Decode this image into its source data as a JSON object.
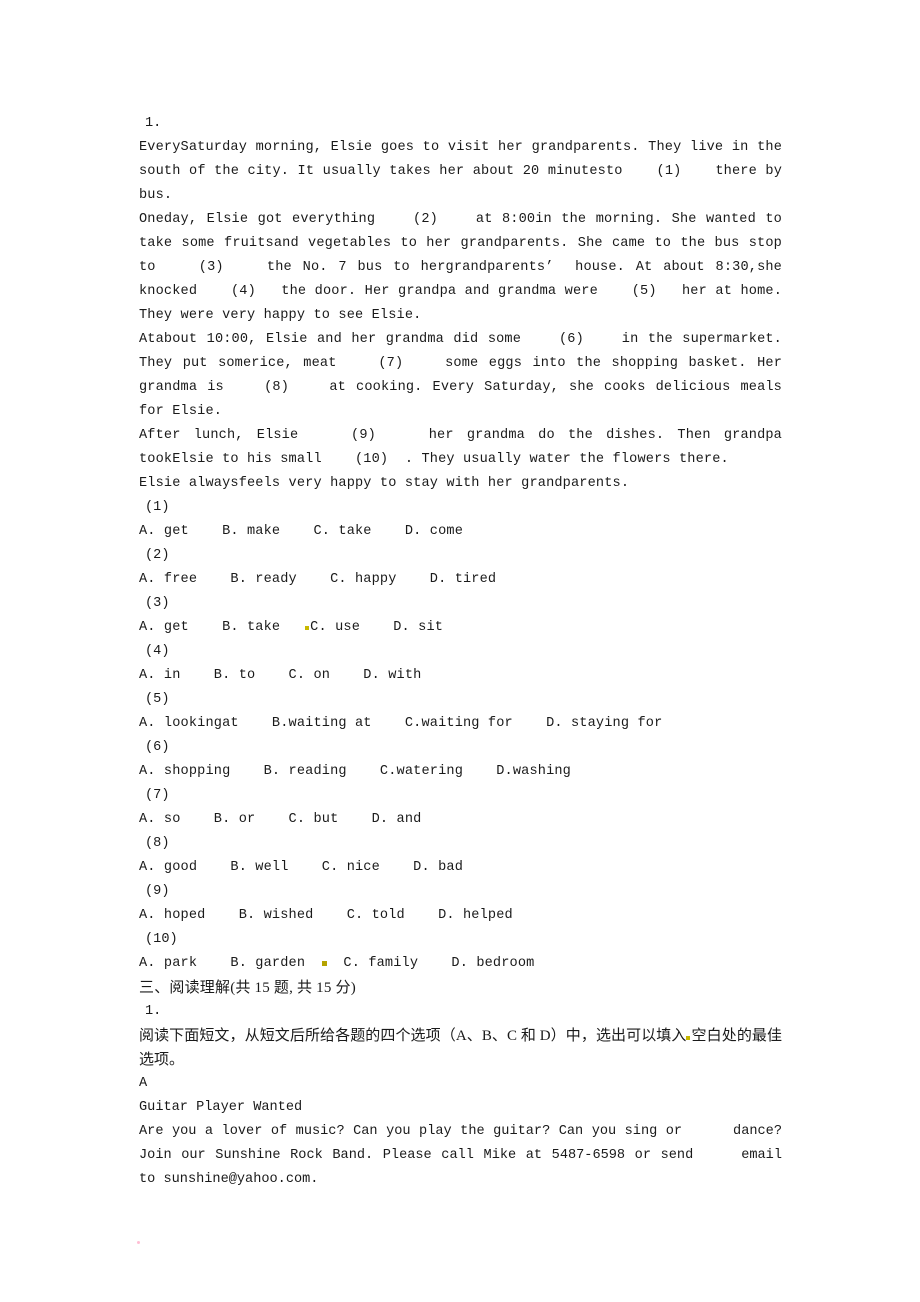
{
  "document": {
    "title": "English Exam Worksheet - Cloze and Reading Comprehension",
    "cloze": {
      "number": "1.",
      "paragraphs": [
        "EverySaturday morning, Elsie goes to visit her grandparents. They live in the south of the city. It usually takes her about 20 minutesto    (1)    there by bus.",
        "Oneday, Elsie got everything    (2)    at 8:00in the morning. She wanted to take some fruitsand vegetables to her grandparents. She came to the bus stop to    (3)    the No. 7 bus to hergrandparents’  house. At about 8:30,she knocked    (4)   the door. Her grandpa and grandma were    (5)   her at home. They were very happy to see Elsie.",
        "Atabout 10:00, Elsie and her grandma did some    (6)    in the supermarket. They put somerice, meat    (7)    some eggs into the shopping basket. Her grandma is    (8)    at cooking. Every Saturday, she cooks delicious meals for Elsie.",
        "After lunch, Elsie    (9)    her grandma do the dishes. Then grandpa tookElsie to his small    (10)  . They usually water the flowers there.",
        "Elsie alwaysfeels very happy to stay with her grandparents."
      ],
      "questions": [
        {
          "index": "(1)",
          "options": "A. get    B. make    C. take    D. come"
        },
        {
          "index": "(2)",
          "options": "A. free    B. ready    C. happy    D. tired"
        },
        {
          "index": "(3)",
          "options_pre": "A. get    B. take   ",
          "options_post": "C. use    D. sit",
          "has_mark": true
        },
        {
          "index": "(4)",
          "options": "A. in    B. to    C. on    D. with"
        },
        {
          "index": "(5)",
          "options": "A. lookingat    B.waiting at    C.waiting for    D. staying for"
        },
        {
          "index": "(6)",
          "options": "A. shopping    B. reading    C.watering    D.washing"
        },
        {
          "index": "(7)",
          "options": "A. so    B. or    C. but    D. and"
        },
        {
          "index": "(8)",
          "options": "A. good    B. well    C. nice    D. bad"
        },
        {
          "index": "(9)",
          "options": "A. hoped    B. wished    C. told    D. helped"
        },
        {
          "index": "(10)",
          "options_pre": "A. park    B. garden  ",
          "options_post": "  C. family    D. bedroom",
          "has_mark": true
        }
      ]
    },
    "reading": {
      "section_heading": "三、阅读理解(共 15 题, 共 15 分)",
      "number": "1.",
      "instruction_pre": "阅读下面短文，从短文后所给各题的四个选项（A、B、C 和 D）中，选出可以填入",
      "instruction_post": "空白处的最佳选项。",
      "passage_label": "A",
      "passage_title": "Guitar Player Wanted",
      "passage_body": "Are you a lover of music? Can you play the guitar? Can you sing or      dance? Join our Sunshine Rock Band. Please call Mike at 5487-6598 or send     email to sunshine@yahoo.com."
    }
  }
}
